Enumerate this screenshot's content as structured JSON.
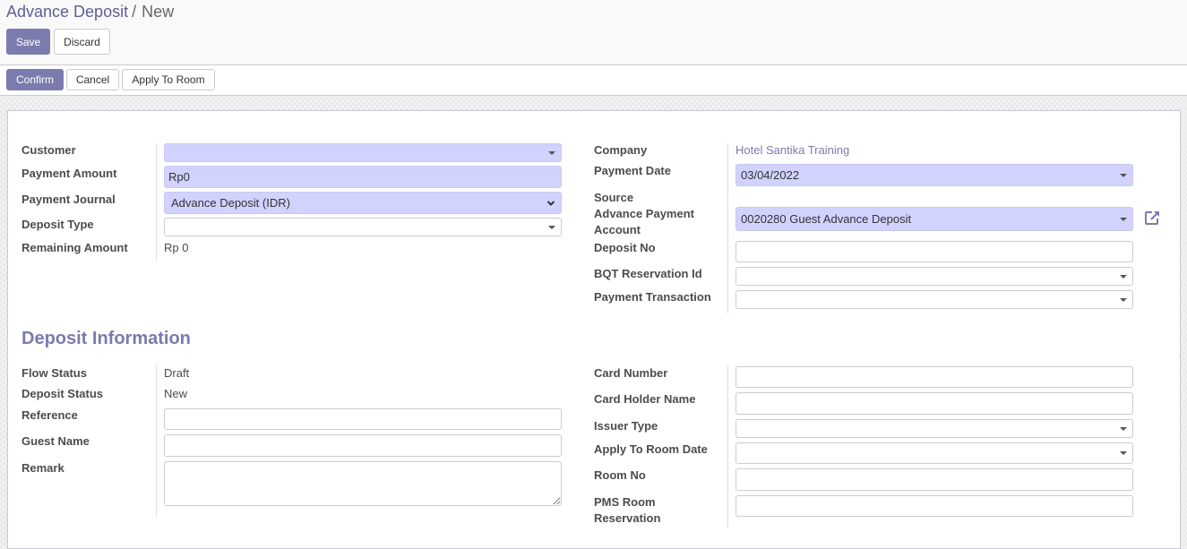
{
  "breadcrumb": {
    "parent": "Advance Deposit",
    "separator": "/",
    "current": "New"
  },
  "control_buttons": {
    "save": "Save",
    "discard": "Discard"
  },
  "status_buttons": {
    "confirm": "Confirm",
    "cancel": "Cancel",
    "apply_to_room": "Apply To Room"
  },
  "left_group": {
    "customer": {
      "label": "Customer",
      "value": ""
    },
    "payment_amount": {
      "label": "Payment Amount",
      "value": "Rp0"
    },
    "payment_journal": {
      "label": "Payment Journal",
      "value": "Advance Deposit (IDR)"
    },
    "deposit_type": {
      "label": "Deposit Type",
      "value": ""
    },
    "remaining_amount": {
      "label": "Remaining Amount",
      "value": "Rp 0"
    }
  },
  "right_group": {
    "company": {
      "label": "Company",
      "value": "Hotel Santika Training"
    },
    "payment_date": {
      "label": "Payment Date",
      "value": "03/04/2022"
    },
    "source_account": {
      "label": "Source Advance Payment Account",
      "label_lines": [
        "Source",
        "Advance Payment",
        "Account"
      ],
      "value": "0020280 Guest Advance Deposit"
    },
    "deposit_no": {
      "label": "Deposit No",
      "value": ""
    },
    "bqt_reservation_id": {
      "label": "BQT Reservation Id",
      "value": ""
    },
    "payment_transaction": {
      "label": "Payment Transaction",
      "value": ""
    }
  },
  "deposit_info": {
    "title": "Deposit Information",
    "flow_status": {
      "label": "Flow Status",
      "value": "Draft"
    },
    "deposit_status": {
      "label": "Deposit Status",
      "value": "New"
    },
    "reference": {
      "label": "Reference",
      "value": ""
    },
    "guest_name": {
      "label": "Guest Name",
      "value": ""
    },
    "remark": {
      "label": "Remark",
      "value": ""
    },
    "card_number": {
      "label": "Card Number",
      "value": ""
    },
    "card_holder_name": {
      "label": "Card Holder Name",
      "value": ""
    },
    "issuer_type": {
      "label": "Issuer Type",
      "value": ""
    },
    "apply_to_room_date": {
      "label": "Apply To Room Date",
      "value": ""
    },
    "room_no": {
      "label": "Room No",
      "value": ""
    },
    "pms_room_reservation": {
      "label": "PMS Room Reservation",
      "label_lines": [
        "PMS Room",
        "Reservation"
      ],
      "value": ""
    }
  },
  "colors": {
    "accent": "#7c7bad",
    "required_field": "#d2d2ff",
    "link": "#5f5e97"
  }
}
